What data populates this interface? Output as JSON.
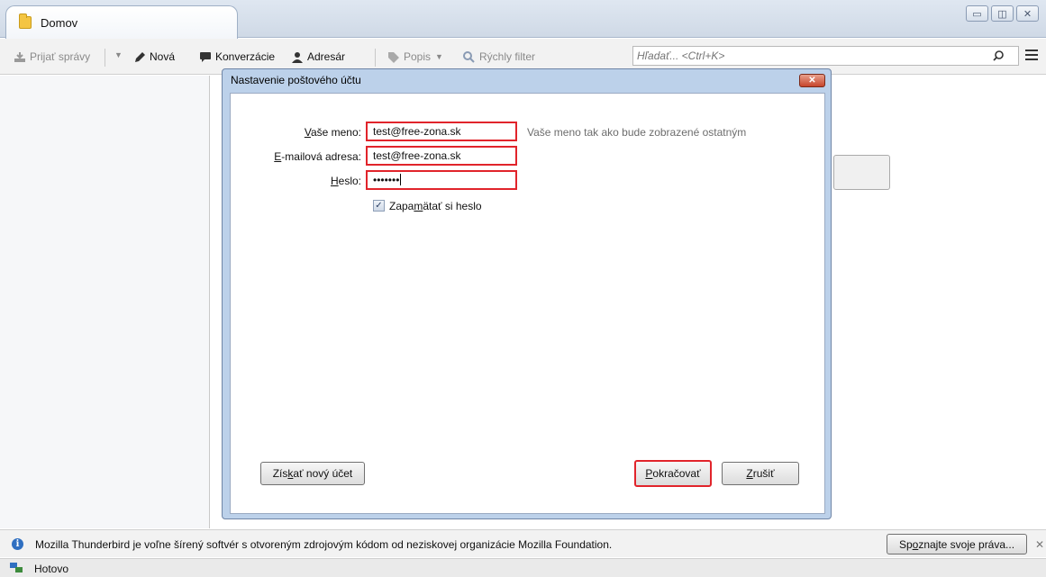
{
  "tab": {
    "label": "Domov"
  },
  "window_buttons": {
    "minimize": "▭",
    "restore": "◫",
    "close": "✕"
  },
  "toolbar": {
    "get_messages": "Prijať správy",
    "new": "Nová",
    "chat": "Konverzácie",
    "address_book": "Adresár",
    "tag": "Popis",
    "quick_filter": "Rýchly filter",
    "search_placeholder": "Hľadať... <Ctrl+K>"
  },
  "dialog": {
    "title": "Nastavenie poštového účtu",
    "name_label_underlined": "V",
    "name_label_rest": "aše meno:",
    "name_value": "test@free-zona.sk",
    "name_hint": "Vaše meno tak ako bude zobrazené ostatným",
    "email_label_underlined": "E",
    "email_label_rest": "-mailová adresa:",
    "email_value": "test@free-zona.sk",
    "password_label_underlined": "H",
    "password_label_rest": "eslo:",
    "password_value": "•••••••",
    "remember_label_pre": "Zapa",
    "remember_label_underlined": "m",
    "remember_label_post": "ätať si heslo",
    "remember_checked": true,
    "new_account_pre": "Zís",
    "new_account_underlined": "k",
    "new_account_post": "ať nový účet",
    "continue_underlined": "P",
    "continue_rest": "okračovať",
    "cancel_underlined": "Z",
    "cancel_rest": "rušiť"
  },
  "notification": {
    "text": "Mozilla Thunderbird je voľne šírený softvér s otvoreným zdrojovým kódom od neziskovej organizácie Mozilla Foundation.",
    "button_pre": "Sp",
    "button_underlined": "o",
    "button_post": "znajte svoje práva...",
    "close": "✕"
  },
  "status": {
    "text": "Hotovo"
  },
  "colors": {
    "highlight": "#e1242b",
    "dialog_frame": "#bcd1ea"
  }
}
